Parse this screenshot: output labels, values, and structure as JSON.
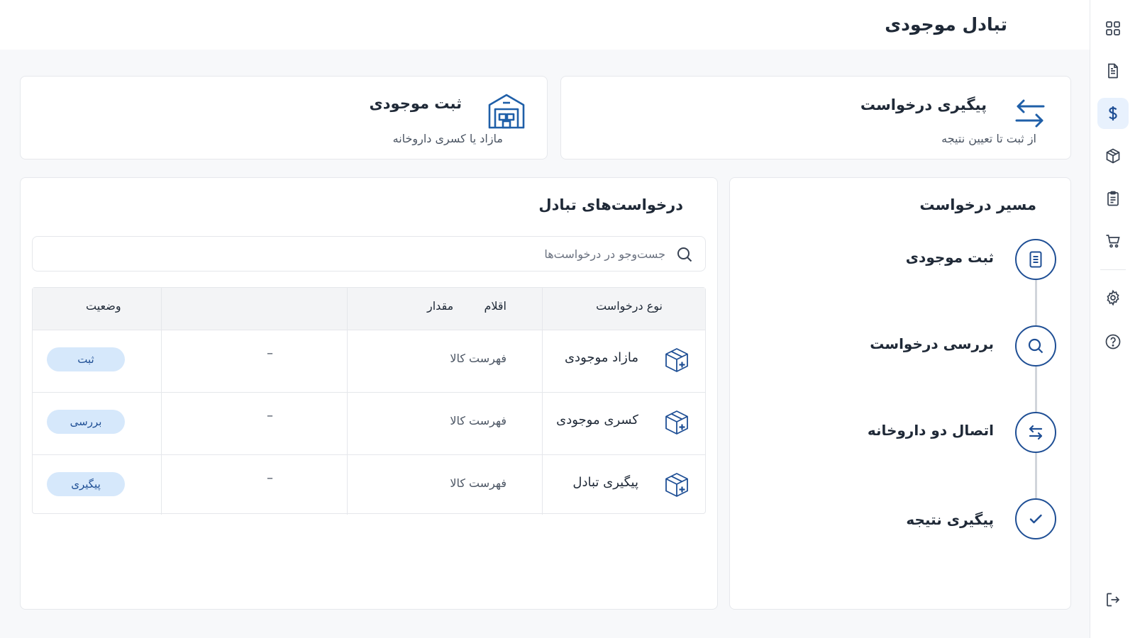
{
  "header": {
    "title": "تبادل موجودی"
  },
  "cards": {
    "follow": {
      "title": "پیگیری درخواست",
      "subtitle": "از ثبت تا تعیین نتیجه"
    },
    "register": {
      "title": "ثبت موجودی",
      "subtitle": "مازاد یا کسری داروخانه"
    }
  },
  "steps": {
    "title": "مسیر درخواست",
    "items": [
      {
        "label": "ثبت موجودی",
        "icon": "document-icon"
      },
      {
        "label": "بررسی درخواست",
        "icon": "search-icon"
      },
      {
        "label": "اتصال دو داروخانه",
        "icon": "exchange-icon"
      },
      {
        "label": "پیگیری نتیجه",
        "icon": "check-icon"
      }
    ]
  },
  "requests": {
    "title": "درخواست‌های تبادل",
    "search_placeholder": "جست‌وجو در درخواست‌ها",
    "columns": {
      "type": "نوع درخواست",
      "items": "اقلام",
      "quantity": "مقدار",
      "status": "وضعیت"
    },
    "rows": [
      {
        "type": "مازاد موجودی",
        "items": "فهرست کالا",
        "quantity": "–",
        "status": "ثبت"
      },
      {
        "type": "کسری موجودی",
        "items": "فهرست کالا",
        "quantity": "–",
        "status": "بررسی"
      },
      {
        "type": "پیگیری تبادل",
        "items": "فهرست کالا",
        "quantity": "–",
        "status": "پیگیری"
      }
    ]
  },
  "rail": {
    "items": [
      "grid-icon",
      "document-icon",
      "dollar-icon",
      "box-icon",
      "clipboard-icon",
      "cart-icon",
      "gear-icon",
      "help-icon",
      "logout-icon"
    ],
    "active": "dollar-icon"
  },
  "colors": {
    "accent": "#1f4f95",
    "badge_bg": "#d6e8fb",
    "page_bg": "#f7f8fa"
  }
}
